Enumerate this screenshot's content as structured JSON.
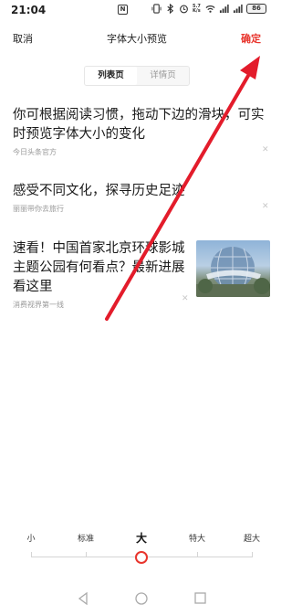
{
  "status_bar": {
    "time": "21:04",
    "nfc_label": "N",
    "speed": "5.7 K/s",
    "battery": "86"
  },
  "header": {
    "cancel_label": "取消",
    "title": "字体大小预览",
    "confirm_label": "确定"
  },
  "tabs": [
    {
      "label": "列表页",
      "active": true
    },
    {
      "label": "详情页",
      "active": false
    }
  ],
  "feed": [
    {
      "title": "你可根据阅读习惯，拖动下边的滑块，可实时预览字体大小的变化",
      "source": "今日头条官方"
    },
    {
      "title": "感受不同文化，探寻历史足迹",
      "source": "丽丽带你去旅行"
    },
    {
      "title": "速看！中国首家北京环球影城主题公园有何看点？最新进展看这里",
      "source": "消费视界第一线",
      "thumbnail": "universal-globe-photo"
    }
  ],
  "font_sizes": {
    "options": [
      "小",
      "标准",
      "大",
      "特大",
      "超大"
    ],
    "selected_index": 2
  },
  "colors": {
    "accent": "#e8352d",
    "text": "#1a1a1a",
    "muted": "#999999"
  },
  "overlay": {
    "annotation": "red-arrow-pointing-to-confirm"
  }
}
